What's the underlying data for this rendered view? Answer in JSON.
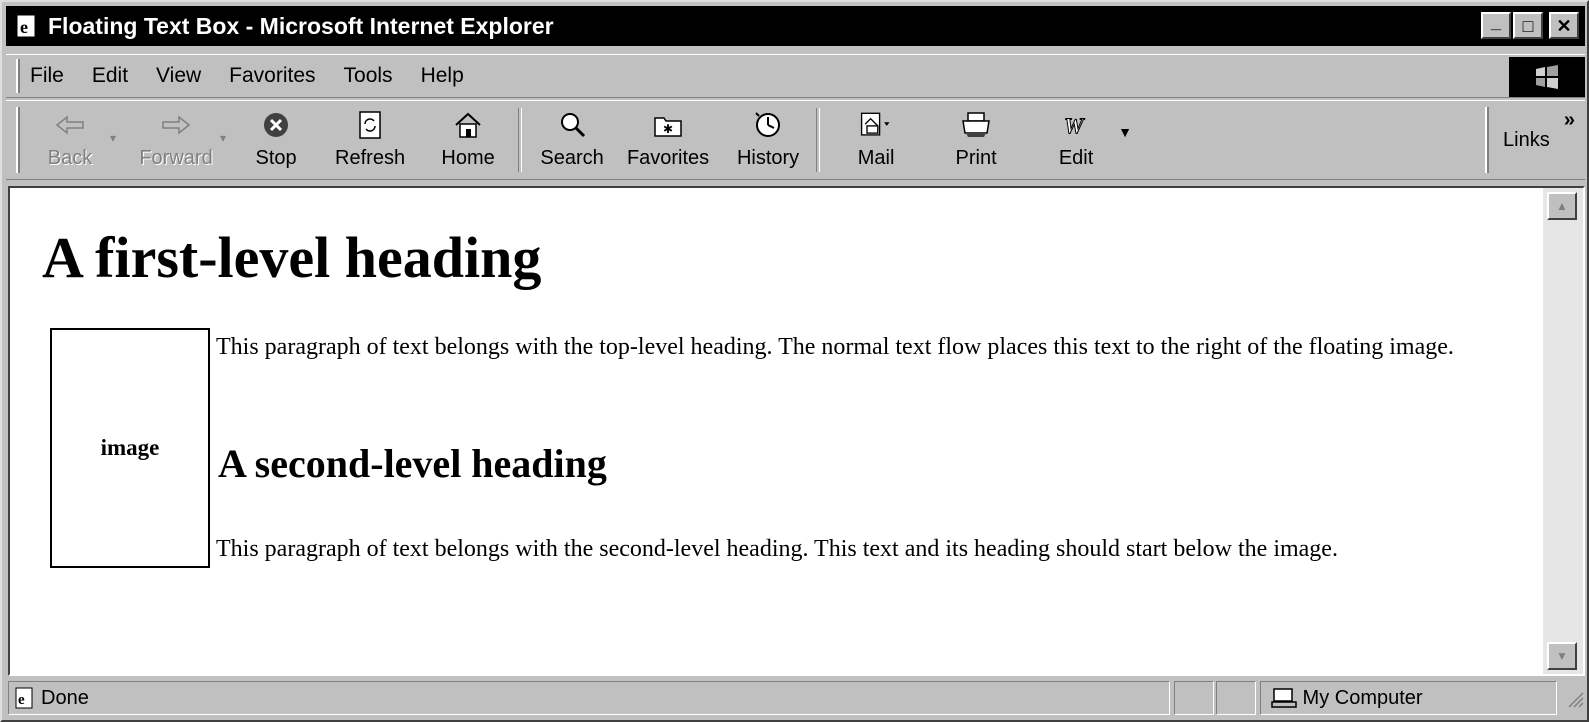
{
  "window": {
    "title": "Floating Text Box - Microsoft Internet Explorer",
    "controls": {
      "minimize": "_",
      "maximize": "□",
      "close": "✕"
    }
  },
  "menu": [
    {
      "label": "File"
    },
    {
      "label": "Edit"
    },
    {
      "label": "View"
    },
    {
      "label": "Favorites"
    },
    {
      "label": "Tools"
    },
    {
      "label": "Help"
    }
  ],
  "toolbar": {
    "back": "Back",
    "forward": "Forward",
    "stop": "Stop",
    "refresh": "Refresh",
    "home": "Home",
    "search": "Search",
    "favorites": "Favorites",
    "history": "History",
    "mail": "Mail",
    "print": "Print",
    "edit": "Edit",
    "links": "Links"
  },
  "page": {
    "h1": "A first-level heading",
    "image_label": "image",
    "p1": "This paragraph of text belongs with the top-level heading. The normal text flow places this text to the right of the floating image.",
    "h2": "A second-level heading",
    "p2": "This paragraph of text belongs with the second-level heading. This text and its heading should start below the image."
  },
  "status": {
    "text": "Done",
    "zone": "My Computer"
  }
}
